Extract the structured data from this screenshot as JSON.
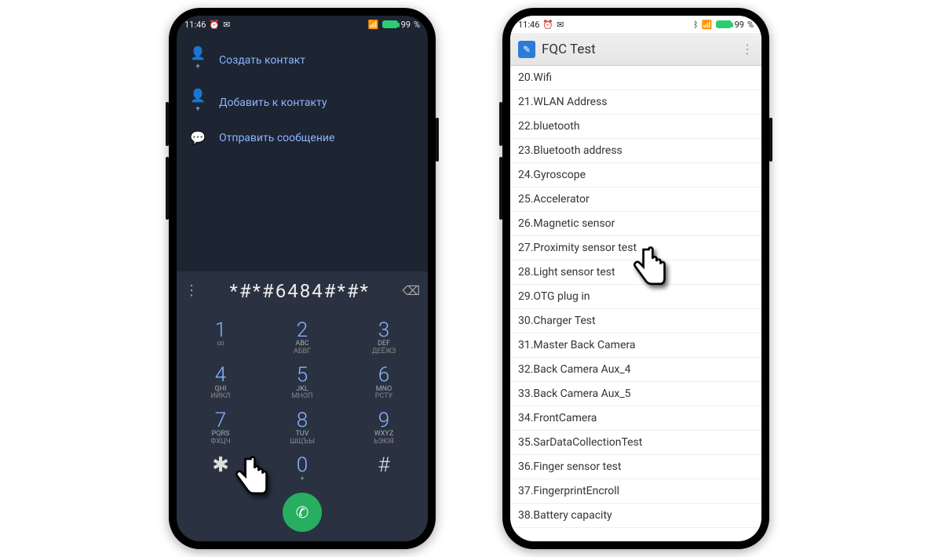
{
  "status": {
    "time": "11:46",
    "battery_pct": "99",
    "battery_unit": "%"
  },
  "dialer": {
    "menu": [
      {
        "icon": "person-add",
        "label": "Создать контакт"
      },
      {
        "icon": "person-add",
        "label": "Добавить к контакту"
      },
      {
        "icon": "message",
        "label": "Отправить сообщение"
      }
    ],
    "entered_code": "*#*#6484#*#*",
    "keys": [
      [
        {
          "d": "1",
          "l1": "",
          "l2": "∞"
        },
        {
          "d": "2",
          "l1": "ABC",
          "l2": "АБВГ"
        },
        {
          "d": "3",
          "l1": "DEF",
          "l2": "ДЕЁЖЗ"
        }
      ],
      [
        {
          "d": "4",
          "l1": "GHI",
          "l2": "ИЙКЛ"
        },
        {
          "d": "5",
          "l1": "JKL",
          "l2": "МНОП"
        },
        {
          "d": "6",
          "l1": "MNO",
          "l2": "РСТУ"
        }
      ],
      [
        {
          "d": "7",
          "l1": "PQRS",
          "l2": "ФХЦЧ"
        },
        {
          "d": "8",
          "l1": "TUV",
          "l2": "ШЩЪЫ"
        },
        {
          "d": "9",
          "l1": "WXYZ",
          "l2": "ЬЭЮЯ"
        }
      ],
      [
        {
          "d": "✱",
          "l1": "",
          "l2": ""
        },
        {
          "d": "0",
          "l1": "+",
          "l2": ""
        },
        {
          "d": "#",
          "l1": "",
          "l2": ""
        }
      ]
    ]
  },
  "fqc": {
    "title": "FQC Test",
    "items": [
      "20.Wifi",
      "21.WLAN Address",
      "22.bluetooth",
      "23.Bluetooth address",
      "24.Gyroscope",
      "25.Accelerator",
      "26.Magnetic sensor",
      "27.Proximity sensor test",
      "28.Light sensor test",
      "29.OTG plug in",
      "30.Charger Test",
      "31.Master Back Camera",
      "32.Back Camera Aux_4",
      "33.Back Camera Aux_5",
      "34.FrontCamera",
      "35.SarDataCollectionTest",
      "36.Finger sensor test",
      "37.FingerprintEncroll",
      "38.Battery capacity"
    ]
  }
}
